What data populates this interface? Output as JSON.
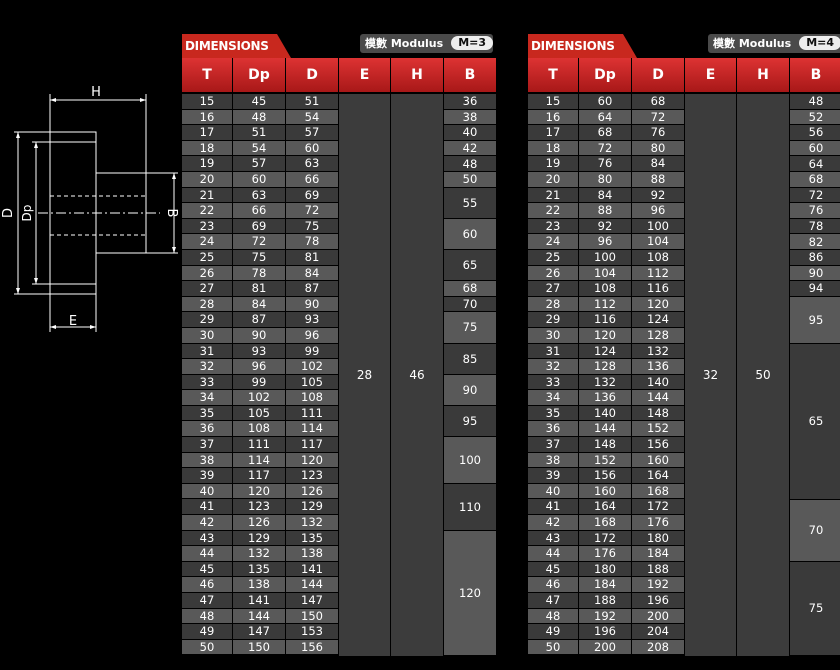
{
  "diagram": {
    "labels": {
      "H": "H",
      "D": "D",
      "Dp": "Dp",
      "B": "B",
      "E": "E"
    }
  },
  "columns": [
    "T",
    "Dp",
    "D",
    "E",
    "H",
    "B"
  ],
  "table1": {
    "header": "DIMENSIONS",
    "modulus_label": "模數 Modulus",
    "modulus_value": "M=3",
    "T": [
      "15",
      "16",
      "17",
      "18",
      "19",
      "20",
      "21",
      "22",
      "23",
      "24",
      "25",
      "26",
      "27",
      "28",
      "29",
      "30",
      "31",
      "32",
      "33",
      "34",
      "35",
      "36",
      "37",
      "38",
      "39",
      "40",
      "41",
      "42",
      "43",
      "44",
      "45",
      "46",
      "47",
      "48",
      "49",
      "50"
    ],
    "Dp": [
      "45",
      "48",
      "51",
      "54",
      "57",
      "60",
      "63",
      "66",
      "69",
      "72",
      "75",
      "78",
      "81",
      "84",
      "87",
      "90",
      "93",
      "96",
      "99",
      "102",
      "105",
      "108",
      "111",
      "114",
      "117",
      "120",
      "123",
      "126",
      "129",
      "132",
      "135",
      "138",
      "141",
      "144",
      "147",
      "150"
    ],
    "D": [
      "51",
      "54",
      "57",
      "60",
      "63",
      "66",
      "69",
      "72",
      "75",
      "78",
      "81",
      "84",
      "87",
      "90",
      "93",
      "96",
      "99",
      "102",
      "105",
      "108",
      "111",
      "114",
      "117",
      "120",
      "123",
      "126",
      "129",
      "132",
      "135",
      "138",
      "141",
      "144",
      "147",
      "150",
      "153",
      "156"
    ],
    "E": "28",
    "H": "46",
    "B_segments": [
      {
        "value": "36",
        "rows": 1
      },
      {
        "value": "38",
        "rows": 1
      },
      {
        "value": "40",
        "rows": 1
      },
      {
        "value": "42",
        "rows": 1
      },
      {
        "value": "48",
        "rows": 1
      },
      {
        "value": "50",
        "rows": 1
      },
      {
        "value": "55",
        "rows": 2
      },
      {
        "value": "60",
        "rows": 2
      },
      {
        "value": "65",
        "rows": 2
      },
      {
        "value": "68",
        "rows": 1
      },
      {
        "value": "70",
        "rows": 1
      },
      {
        "value": "75",
        "rows": 2
      },
      {
        "value": "85",
        "rows": 2
      },
      {
        "value": "90",
        "rows": 2
      },
      {
        "value": "95",
        "rows": 2
      },
      {
        "value": "100",
        "rows": 3
      },
      {
        "value": "110",
        "rows": 3
      },
      {
        "value": "120",
        "rows": 8
      }
    ]
  },
  "table2": {
    "header": "DIMENSIONS",
    "modulus_label": "模數 Modulus",
    "modulus_value": "M=4",
    "T": [
      "15",
      "16",
      "17",
      "18",
      "19",
      "20",
      "21",
      "22",
      "23",
      "24",
      "25",
      "26",
      "27",
      "28",
      "29",
      "30",
      "31",
      "32",
      "33",
      "34",
      "35",
      "36",
      "37",
      "38",
      "39",
      "40",
      "41",
      "42",
      "43",
      "44",
      "45",
      "46",
      "47",
      "48",
      "49",
      "50"
    ],
    "Dp": [
      "60",
      "64",
      "68",
      "72",
      "76",
      "80",
      "84",
      "88",
      "92",
      "96",
      "100",
      "104",
      "108",
      "112",
      "116",
      "120",
      "124",
      "128",
      "132",
      "136",
      "140",
      "144",
      "148",
      "152",
      "156",
      "160",
      "164",
      "168",
      "172",
      "176",
      "180",
      "184",
      "188",
      "192",
      "196",
      "200"
    ],
    "D": [
      "68",
      "72",
      "76",
      "80",
      "84",
      "88",
      "92",
      "96",
      "100",
      "104",
      "108",
      "112",
      "116",
      "120",
      "124",
      "128",
      "132",
      "136",
      "140",
      "144",
      "148",
      "152",
      "156",
      "160",
      "164",
      "168",
      "172",
      "176",
      "180",
      "184",
      "188",
      "192",
      "196",
      "200",
      "204",
      "208"
    ],
    "E": "32",
    "H": "50",
    "B_segments": [
      {
        "value": "48",
        "rows": 1
      },
      {
        "value": "52",
        "rows": 1
      },
      {
        "value": "56",
        "rows": 1
      },
      {
        "value": "60",
        "rows": 1
      },
      {
        "value": "64",
        "rows": 1
      },
      {
        "value": "68",
        "rows": 1
      },
      {
        "value": "72",
        "rows": 1
      },
      {
        "value": "76",
        "rows": 1
      },
      {
        "value": "78",
        "rows": 1
      },
      {
        "value": "82",
        "rows": 1
      },
      {
        "value": "86",
        "rows": 1
      },
      {
        "value": "90",
        "rows": 1
      },
      {
        "value": "94",
        "rows": 1
      },
      {
        "value": "95",
        "rows": 3
      },
      {
        "value": "65",
        "rows": 10
      },
      {
        "value": "70",
        "rows": 4
      },
      {
        "value": "75",
        "rows": 6
      }
    ]
  }
}
